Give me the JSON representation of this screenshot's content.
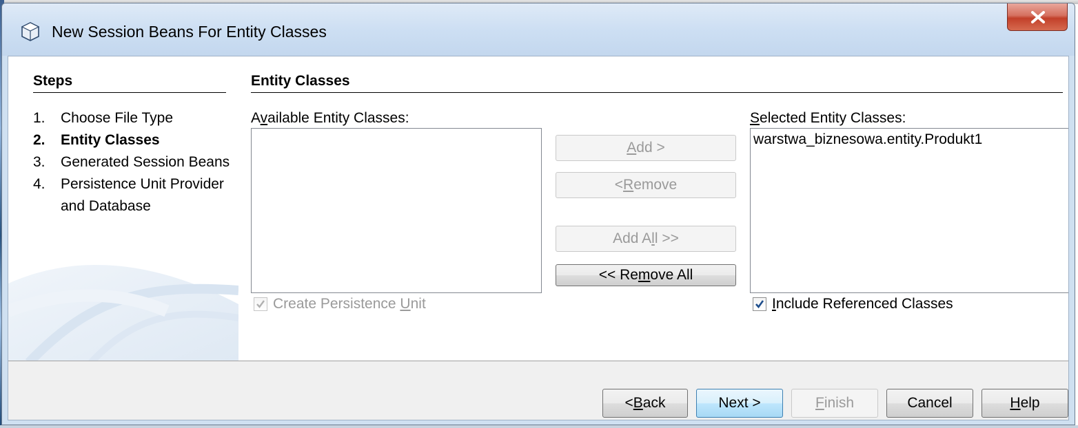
{
  "window": {
    "title": "New Session Beans For Entity Classes"
  },
  "steps": {
    "heading": "Steps",
    "items": [
      {
        "num": "1.",
        "label": "Choose File Type",
        "current": false
      },
      {
        "num": "2.",
        "label": "Entity Classes",
        "current": true
      },
      {
        "num": "3.",
        "label": "Generated Session Beans",
        "current": false
      },
      {
        "num": "4.",
        "label": "Persistence Unit Provider and Database",
        "current": false
      }
    ]
  },
  "content": {
    "heading": "Entity Classes",
    "available_label_pre": "A",
    "available_label_mnemonic": "v",
    "available_label_post": "ailable Entity Classes:",
    "available_items": [],
    "selected_label_mnemonic": "S",
    "selected_label_post": "elected Entity Classes:",
    "selected_items": [
      "warstwa_biznesowa.entity.Produkt1"
    ],
    "buttons": {
      "add_mnemonic": "A",
      "add_post": "dd >",
      "remove_pre": "< ",
      "remove_mnemonic": "R",
      "remove_post": "emove",
      "add_all_pre": "Add A",
      "add_all_mnemonic": "l",
      "add_all_post": "l >>",
      "remove_all_pre": "<< Re",
      "remove_all_mnemonic": "m",
      "remove_all_post": "ove All"
    },
    "create_pu_pre": "Create Persistence ",
    "create_pu_mnemonic": "U",
    "create_pu_post": "nit",
    "create_pu_checked": true,
    "include_ref_mnemonic": "I",
    "include_ref_post": "nclude Referenced Classes",
    "include_ref_checked": true
  },
  "navigation": {
    "back_pre": "< ",
    "back_mnemonic": "B",
    "back_post": "ack",
    "next": "Next >",
    "finish_mnemonic": "F",
    "finish_post": "inish",
    "cancel": "Cancel",
    "help_mnemonic": "H",
    "help_post": "elp"
  },
  "colors": {
    "titlebar": "#cddff3",
    "close_button": "#c2402a",
    "default_button_border": "#3c7fb1",
    "disabled_text": "#9a9a9a"
  }
}
